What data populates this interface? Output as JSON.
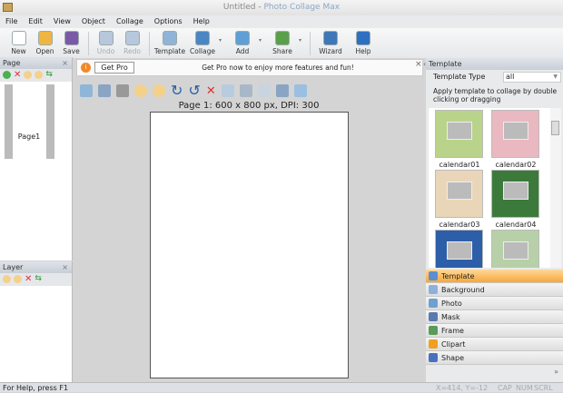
{
  "window": {
    "title_doc": "Untitled - ",
    "title_app": "Photo Collage Max"
  },
  "menu": [
    "File",
    "Edit",
    "View",
    "Object",
    "Collage",
    "Options",
    "Help"
  ],
  "toolbar": [
    {
      "label": "New",
      "color": "#ffffff",
      "enabled": true
    },
    {
      "label": "Open",
      "color": "#f0b540",
      "enabled": true
    },
    {
      "label": "Save",
      "color": "#7a5aa8",
      "enabled": true
    },
    {
      "label": "Undo",
      "color": "#b7c8dc",
      "enabled": false
    },
    {
      "label": "Redo",
      "color": "#b7c8dc",
      "enabled": false
    },
    {
      "label": "Template",
      "color": "#8fb4d8",
      "enabled": true
    },
    {
      "label": "Collage",
      "color": "#4b86c2",
      "enabled": true
    },
    {
      "label": "Add",
      "color": "#5f9fd6",
      "enabled": true
    },
    {
      "label": "Share",
      "color": "#5aa04a",
      "enabled": true
    },
    {
      "label": "Wizard",
      "color": "#3f77b8",
      "enabled": true
    },
    {
      "label": "Help",
      "color": "#2d6fc0",
      "enabled": true
    }
  ],
  "page_panel": {
    "title": "Page",
    "close": "×",
    "pages": [
      {
        "label": "Page1"
      }
    ]
  },
  "layer_panel": {
    "title": "Layer",
    "close": "×"
  },
  "promo": {
    "button": "Get Pro",
    "message": "Get Pro now to enjoy more features and fun!",
    "close": "×"
  },
  "canvas": {
    "page_label": "Page 1: 600 x 800 px, DPI: 300"
  },
  "template_panel": {
    "title": "Template",
    "type_label": "Template Type",
    "type_value": "all",
    "description": "Apply template to collage by double clicking or dragging",
    "templates": [
      {
        "label": "calendar01",
        "color": "#b9d48a"
      },
      {
        "label": "calendar02",
        "color": "#eab8c0"
      },
      {
        "label": "calendar03",
        "color": "#e9d6b8"
      },
      {
        "label": "calendar04",
        "color": "#3c7a3c"
      },
      {
        "label": "",
        "color": "#2d5fa8"
      },
      {
        "label": "",
        "color": "#b8d0a8"
      }
    ],
    "expand": "»"
  },
  "categories": [
    {
      "label": "Template",
      "color": "#5c8ed0",
      "active": true
    },
    {
      "label": "Background",
      "color": "#8fb0d8",
      "active": false
    },
    {
      "label": "Photo",
      "color": "#6fa0d0",
      "active": false
    },
    {
      "label": "Mask",
      "color": "#5a7ab0",
      "active": false
    },
    {
      "label": "Frame",
      "color": "#5a9a5a",
      "active": false
    },
    {
      "label": "Clipart",
      "color": "#f0a020",
      "active": false
    },
    {
      "label": "Shape",
      "color": "#4a70c0",
      "active": false
    }
  ],
  "status": {
    "help": "For Help, press F1",
    "coords": "X=414, Y=-12",
    "cap": "CAP",
    "num": "NUM",
    "scrl": "SCRL"
  }
}
